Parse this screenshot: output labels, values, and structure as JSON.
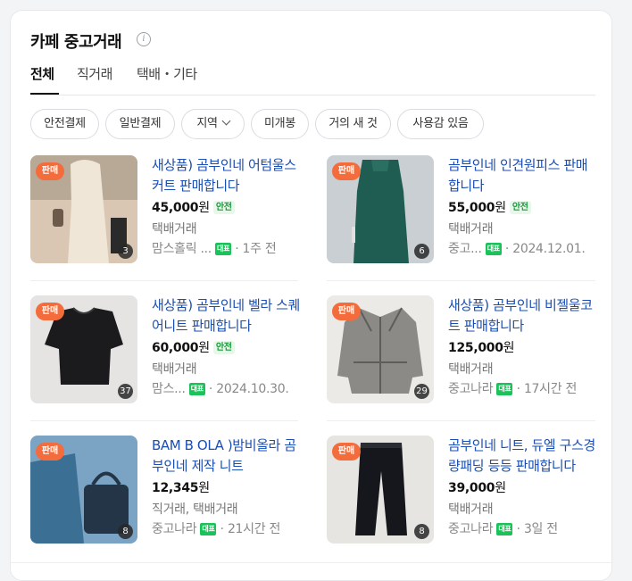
{
  "header": {
    "title": "카페 중고거래",
    "info_icon": "info-icon"
  },
  "tabs": [
    {
      "label": "전체",
      "active": true
    },
    {
      "label": "직거래",
      "active": false
    },
    {
      "label": "택배・기타",
      "active": false
    }
  ],
  "filters": [
    {
      "label": "안전결제"
    },
    {
      "label": "일반결제"
    },
    {
      "label": "지역",
      "has_dropdown": true
    },
    {
      "label": "미개봉"
    },
    {
      "label": "거의 새 것"
    },
    {
      "label": "사용감 있음"
    }
  ],
  "badge_label": "판매",
  "rep_badge_label": "대표",
  "safe_label": "안전",
  "currency": "원",
  "items": [
    {
      "name": "새상품) 곰부인네 어텀울스커트 판매합니다",
      "price": "45,000",
      "safe": true,
      "method": "택배거래",
      "cafe": "맘스홀릭 ...",
      "time": "1주 전",
      "photos": "3",
      "colors": {
        "bg": "#d9c7b3",
        "fg": "#efe6d8",
        "accent": "#6c5a4b"
      }
    },
    {
      "name": "곰부인네 인견원피스 판매합니다",
      "price": "55,000",
      "safe": true,
      "method": "택배거래",
      "cafe": "중고...",
      "time": "2024.12.01.",
      "photos": "6",
      "colors": {
        "bg": "#c9cfd3",
        "fg": "#1f5d52",
        "accent": "#2a6f62"
      }
    },
    {
      "name": "새상품) 곰부인네 벨라 스퀘어니트 판매합니다",
      "price": "60,000",
      "safe": true,
      "method": "택배거래",
      "cafe": "맘스...",
      "time": "2024.10.30.",
      "photos": "37",
      "colors": {
        "bg": "#e6e4e2",
        "fg": "#1b1b1e",
        "accent": "#3a3a3d"
      }
    },
    {
      "name": "새상품) 곰부인네 비젤울코트 판매합니다",
      "price": "125,000",
      "safe": false,
      "method": "택배거래",
      "cafe": "중고나라",
      "time": "17시간 전",
      "photos": "29",
      "colors": {
        "bg": "#eceae7",
        "fg": "#8c8a86",
        "accent": "#5f5d5a"
      }
    },
    {
      "name": "BAM B OLA )밤비올라 곰부인네 제작 니트",
      "price": "12,345",
      "safe": false,
      "method": "직거래, 택배거래",
      "cafe": "중고나라",
      "time": "21시간 전",
      "photos": "8",
      "colors": {
        "bg": "#7aa3c4",
        "fg": "#3b6f94",
        "accent": "#233547"
      }
    },
    {
      "name": "곰부인네 니트, 듀엘 구스경량패딩 등등 판매합니다",
      "price": "39,000",
      "safe": false,
      "method": "택배거래",
      "cafe": "중고나라",
      "time": "3일 전",
      "photos": "8",
      "colors": {
        "bg": "#e7e5e2",
        "fg": "#15171c",
        "accent": "#2a2d33"
      }
    }
  ]
}
